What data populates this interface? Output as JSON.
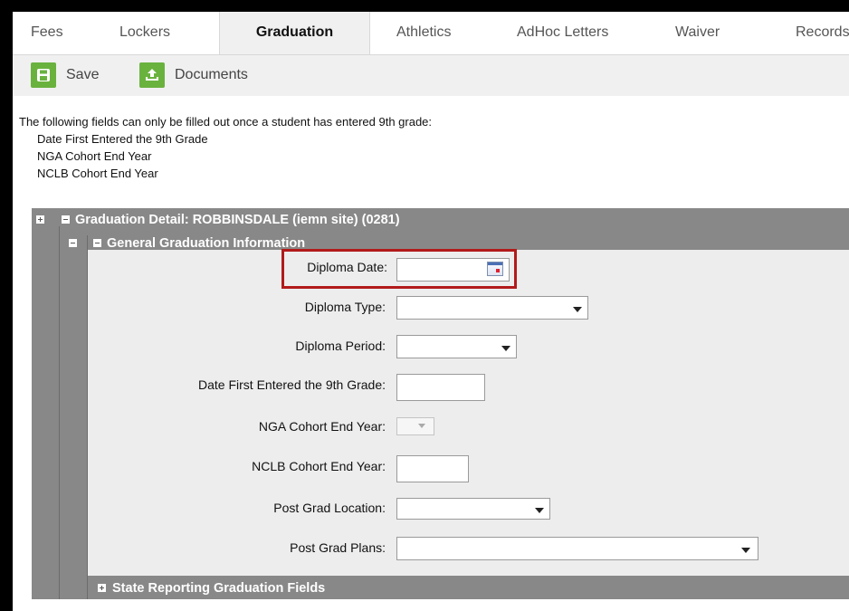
{
  "tabs": [
    {
      "label": "Fees",
      "active": false
    },
    {
      "label": "Lockers",
      "active": false
    },
    {
      "label": "Graduation",
      "active": true
    },
    {
      "label": "Athletics",
      "active": false
    },
    {
      "label": "AdHoc Letters",
      "active": false
    },
    {
      "label": "Waiver",
      "active": false
    },
    {
      "label": "Records",
      "active": false
    }
  ],
  "toolbar": {
    "save_label": "Save",
    "documents_label": "Documents",
    "save_icon": "floppy-disk-icon",
    "documents_icon": "upload-icon",
    "icon_color": "#6ab23e"
  },
  "notice": {
    "intro": "The following fields can only be filled out once a student has entered 9th grade:",
    "items": [
      "Date First Entered the 9th Grade",
      "NGA Cohort End Year",
      "NCLB Cohort End Year"
    ]
  },
  "panel": {
    "graduation_detail_title": "Graduation Detail: ROBBINSDALE (iemn site) (0281)",
    "general_section_title": "General Graduation Information",
    "state_section_title": "State Reporting Graduation Fields"
  },
  "form": {
    "diploma_date": {
      "label": "Diploma Date:",
      "value": ""
    },
    "diploma_type": {
      "label": "Diploma Type:",
      "value": ""
    },
    "diploma_period": {
      "label": "Diploma Period:",
      "value": ""
    },
    "date_first_9th": {
      "label": "Date First Entered the 9th Grade:",
      "value": ""
    },
    "nga_cohort": {
      "label": "NGA Cohort End Year:",
      "value": ""
    },
    "nclb_cohort": {
      "label": "NCLB Cohort End Year:",
      "value": ""
    },
    "post_grad_location": {
      "label": "Post Grad Location:",
      "value": ""
    },
    "post_grad_plans": {
      "label": "Post Grad Plans:",
      "value": ""
    }
  },
  "colors": {
    "panel_gray": "#888888",
    "form_bg": "#ededed",
    "highlight": "#b21a1a"
  }
}
